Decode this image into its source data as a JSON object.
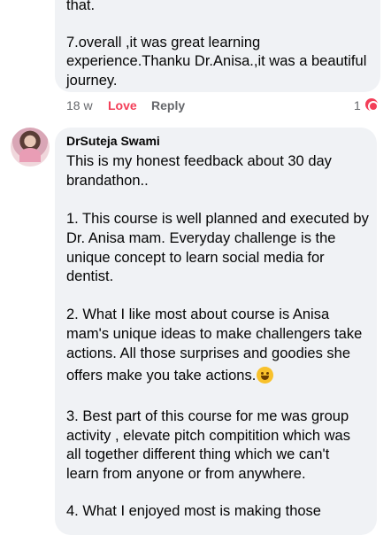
{
  "first_comment": {
    "lines": [
      "that.",
      "7.overall ,it was great learning",
      "experience.Thanku Dr.Anisa.,it was a beautiful",
      "journey."
    ],
    "time": "18 w",
    "love_label": "Love",
    "reply_label": "Reply",
    "reaction_count": "1"
  },
  "second_comment": {
    "author": "DrSuteja Swami",
    "lines": [
      "This is my honest feedback about 30 day",
      "brandathon..",
      "1. This course is well planned and executed by",
      "Dr.  Anisa mam. Everyday challenge is the",
      "unique concept to learn social media for",
      "dentist.",
      "2. What I like most about course is Anisa",
      "mam's unique ideas to make challengers  take",
      "actions. All those surprises and goodies she",
      "offers make you take actions.",
      "3. Best part of this course for me was group",
      "activity , elevate pitch compitition which was",
      "all together different thing which we can't",
      "learn from anyone or from anywhere.",
      "4. What I enjoyed most is making those"
    ],
    "emoji": "grinning-face-emoji"
  }
}
